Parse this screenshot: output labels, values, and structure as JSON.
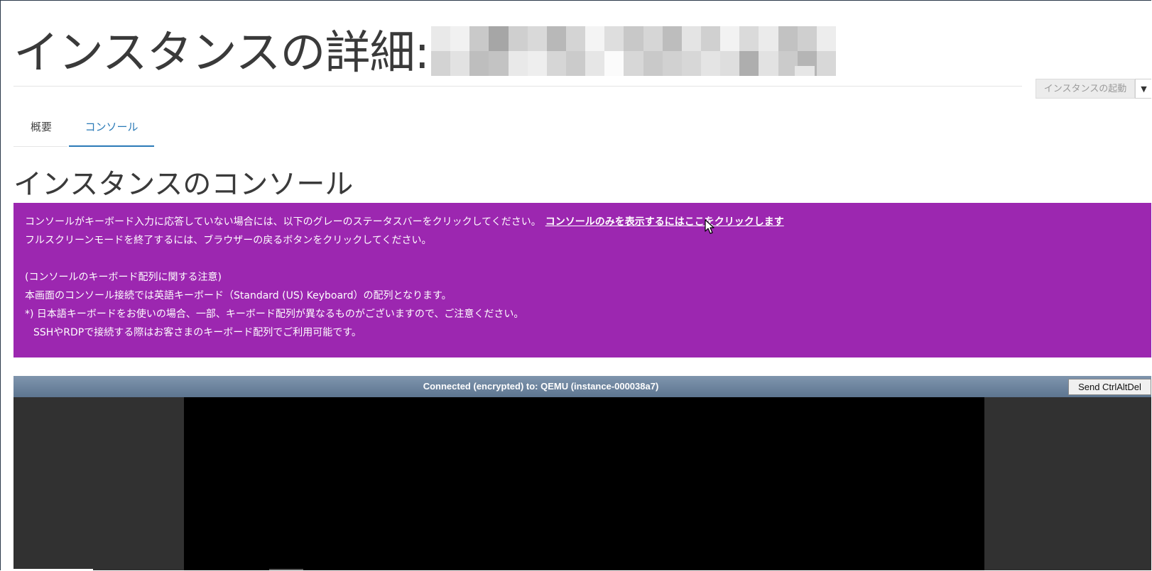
{
  "header": {
    "title": "インスタンスの詳細:",
    "launch_button_label": "インスタンスの起動",
    "redacted_shades": [
      "#e9e9e9",
      "#f1f1f1",
      "#c9c9c9",
      "#a6a6a6",
      "#cfcfcf",
      "#d9d9d9",
      "#b8b8b8",
      "#d4d4d4",
      "#f4f4f4",
      "#dedede",
      "#c8c8c8",
      "#d6d6d6",
      "#bdbdbd",
      "#e4e4e4",
      "#d0d0d0",
      "#f2f2f2",
      "#dadada",
      "#ebebeb",
      "#c2c2c2",
      "#cfcfcf",
      "#ededed",
      "#d3d3d3",
      "#e2e2e2",
      "#bebebe",
      "#c3c3c3",
      "#e9e9e9",
      "#eeeeee",
      "#d6d6d6",
      "#cbcbcb",
      "#e6e6e6",
      "#fbfbfb",
      "#d7d7d7",
      "#c9c9c9",
      "#d1d1d1",
      "#d7d7d7",
      "#e4e4e4",
      "#dedede",
      "#aeaeae",
      "#e2e2e2",
      "#cbcbcb",
      "#b5b5b5",
      "#d8d8d8"
    ]
  },
  "tabs": [
    {
      "label": "概要",
      "active": false
    },
    {
      "label": "コンソール",
      "active": true
    }
  ],
  "section": {
    "title": "インスタンスのコンソール"
  },
  "notice": {
    "line1": "コンソールがキーボード入力に応答していない場合には、以下のグレーのステータスバーをクリックしてください。",
    "link": "コンソールのみを表示するにはここをクリックします",
    "line2": "フルスクリーンモードを終了するには、ブラウザーの戻るボタンをクリックしてください。",
    "line3": "(コンソールのキーボード配列に関する注意)",
    "line4": "本画面のコンソール接続では英語キーボード（Standard (US) Keyboard）の配列となります。",
    "line5": "*) 日本語キーボードをお使いの場合、一部、キーボード配列が異なるものがございますので、ご注意ください。",
    "line6": "SSHやRDPで接続する際はお客さまのキーボード配列でご利用可能です。",
    "background": "#9c27b0"
  },
  "console": {
    "status": "Connected (encrypted) to: QEMU (instance-000038a7)",
    "ctrl_alt_del_label": "Send CtrlAltDel"
  },
  "colors": {
    "accent": "#2a7ab7",
    "title_text": "#3a3a3a"
  }
}
